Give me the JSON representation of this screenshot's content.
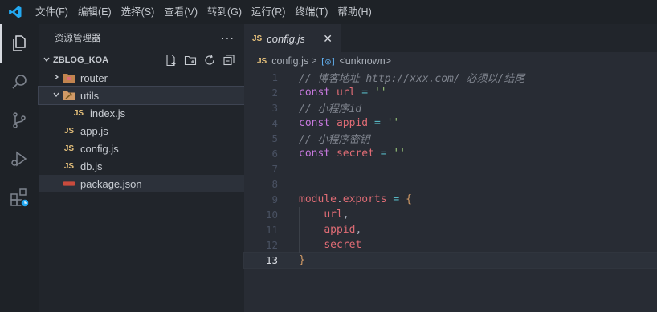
{
  "menubar": {
    "items": [
      "文件(F)",
      "编辑(E)",
      "选择(S)",
      "查看(V)",
      "转到(G)",
      "运行(R)",
      "终端(T)",
      "帮助(H)"
    ]
  },
  "sidebar": {
    "title": "资源管理器",
    "more": "···",
    "section_title": "ZBLOG_KOA",
    "tree": [
      {
        "name": "router",
        "type": "folder",
        "expanded": false
      },
      {
        "name": "utils",
        "type": "folder",
        "expanded": true
      },
      {
        "name": "index.js",
        "type": "js"
      },
      {
        "name": "app.js",
        "type": "js"
      },
      {
        "name": "config.js",
        "type": "js"
      },
      {
        "name": "db.js",
        "type": "js"
      },
      {
        "name": "package.json",
        "type": "json"
      }
    ]
  },
  "editor": {
    "tab_label": "config.js",
    "tab_icon": "JS",
    "breadcrumb": {
      "file": "config.js",
      "symbol": "<unknown>"
    },
    "current_line": 13,
    "lines": [
      {
        "n": "1",
        "tokens": [
          [
            "tk-comment",
            "// 博客地址 "
          ],
          [
            "tk-link",
            "http://xxx.com/"
          ],
          [
            "tk-comment",
            " 必须以/结尾"
          ]
        ]
      },
      {
        "n": "2",
        "tokens": [
          [
            "tk-kw",
            "const"
          ],
          [
            "tk-plain",
            " "
          ],
          [
            "tk-var",
            "url"
          ],
          [
            "tk-plain",
            " "
          ],
          [
            "tk-op",
            "="
          ],
          [
            "tk-plain",
            " "
          ],
          [
            "tk-str",
            "''"
          ]
        ]
      },
      {
        "n": "3",
        "tokens": [
          [
            "tk-comment",
            "// 小程序id"
          ]
        ]
      },
      {
        "n": "4",
        "tokens": [
          [
            "tk-kw",
            "const"
          ],
          [
            "tk-plain",
            " "
          ],
          [
            "tk-var",
            "appid"
          ],
          [
            "tk-plain",
            " "
          ],
          [
            "tk-op",
            "="
          ],
          [
            "tk-plain",
            " "
          ],
          [
            "tk-str",
            "''"
          ]
        ]
      },
      {
        "n": "5",
        "tokens": [
          [
            "tk-comment",
            "// 小程序密钥"
          ]
        ]
      },
      {
        "n": "6",
        "tokens": [
          [
            "tk-kw",
            "const"
          ],
          [
            "tk-plain",
            " "
          ],
          [
            "tk-var",
            "secret"
          ],
          [
            "tk-plain",
            " "
          ],
          [
            "tk-op",
            "="
          ],
          [
            "tk-plain",
            " "
          ],
          [
            "tk-str",
            "''"
          ]
        ]
      },
      {
        "n": "7",
        "tokens": []
      },
      {
        "n": "8",
        "tokens": []
      },
      {
        "n": "9",
        "tokens": [
          [
            "tk-var",
            "module"
          ],
          [
            "tk-punc",
            "."
          ],
          [
            "tk-var",
            "exports"
          ],
          [
            "tk-plain",
            " "
          ],
          [
            "tk-op",
            "="
          ],
          [
            "tk-plain",
            " "
          ],
          [
            "tk-brace",
            "{"
          ]
        ]
      },
      {
        "n": "10",
        "tokens": [
          [
            "tk-plain",
            "    "
          ],
          [
            "tk-var",
            "url"
          ],
          [
            "tk-punc",
            ","
          ]
        ]
      },
      {
        "n": "11",
        "tokens": [
          [
            "tk-plain",
            "    "
          ],
          [
            "tk-var",
            "appid"
          ],
          [
            "tk-punc",
            ","
          ]
        ]
      },
      {
        "n": "12",
        "tokens": [
          [
            "tk-plain",
            "    "
          ],
          [
            "tk-var",
            "secret"
          ]
        ]
      },
      {
        "n": "13",
        "tokens": [
          [
            "tk-brace",
            "}"
          ]
        ]
      }
    ]
  },
  "colors": {
    "accent": "#23a9f2",
    "js": "#e5c07b",
    "keyword": "#c678dd",
    "variable": "#e06c75",
    "string": "#98c379",
    "comment": "#7f848e"
  }
}
